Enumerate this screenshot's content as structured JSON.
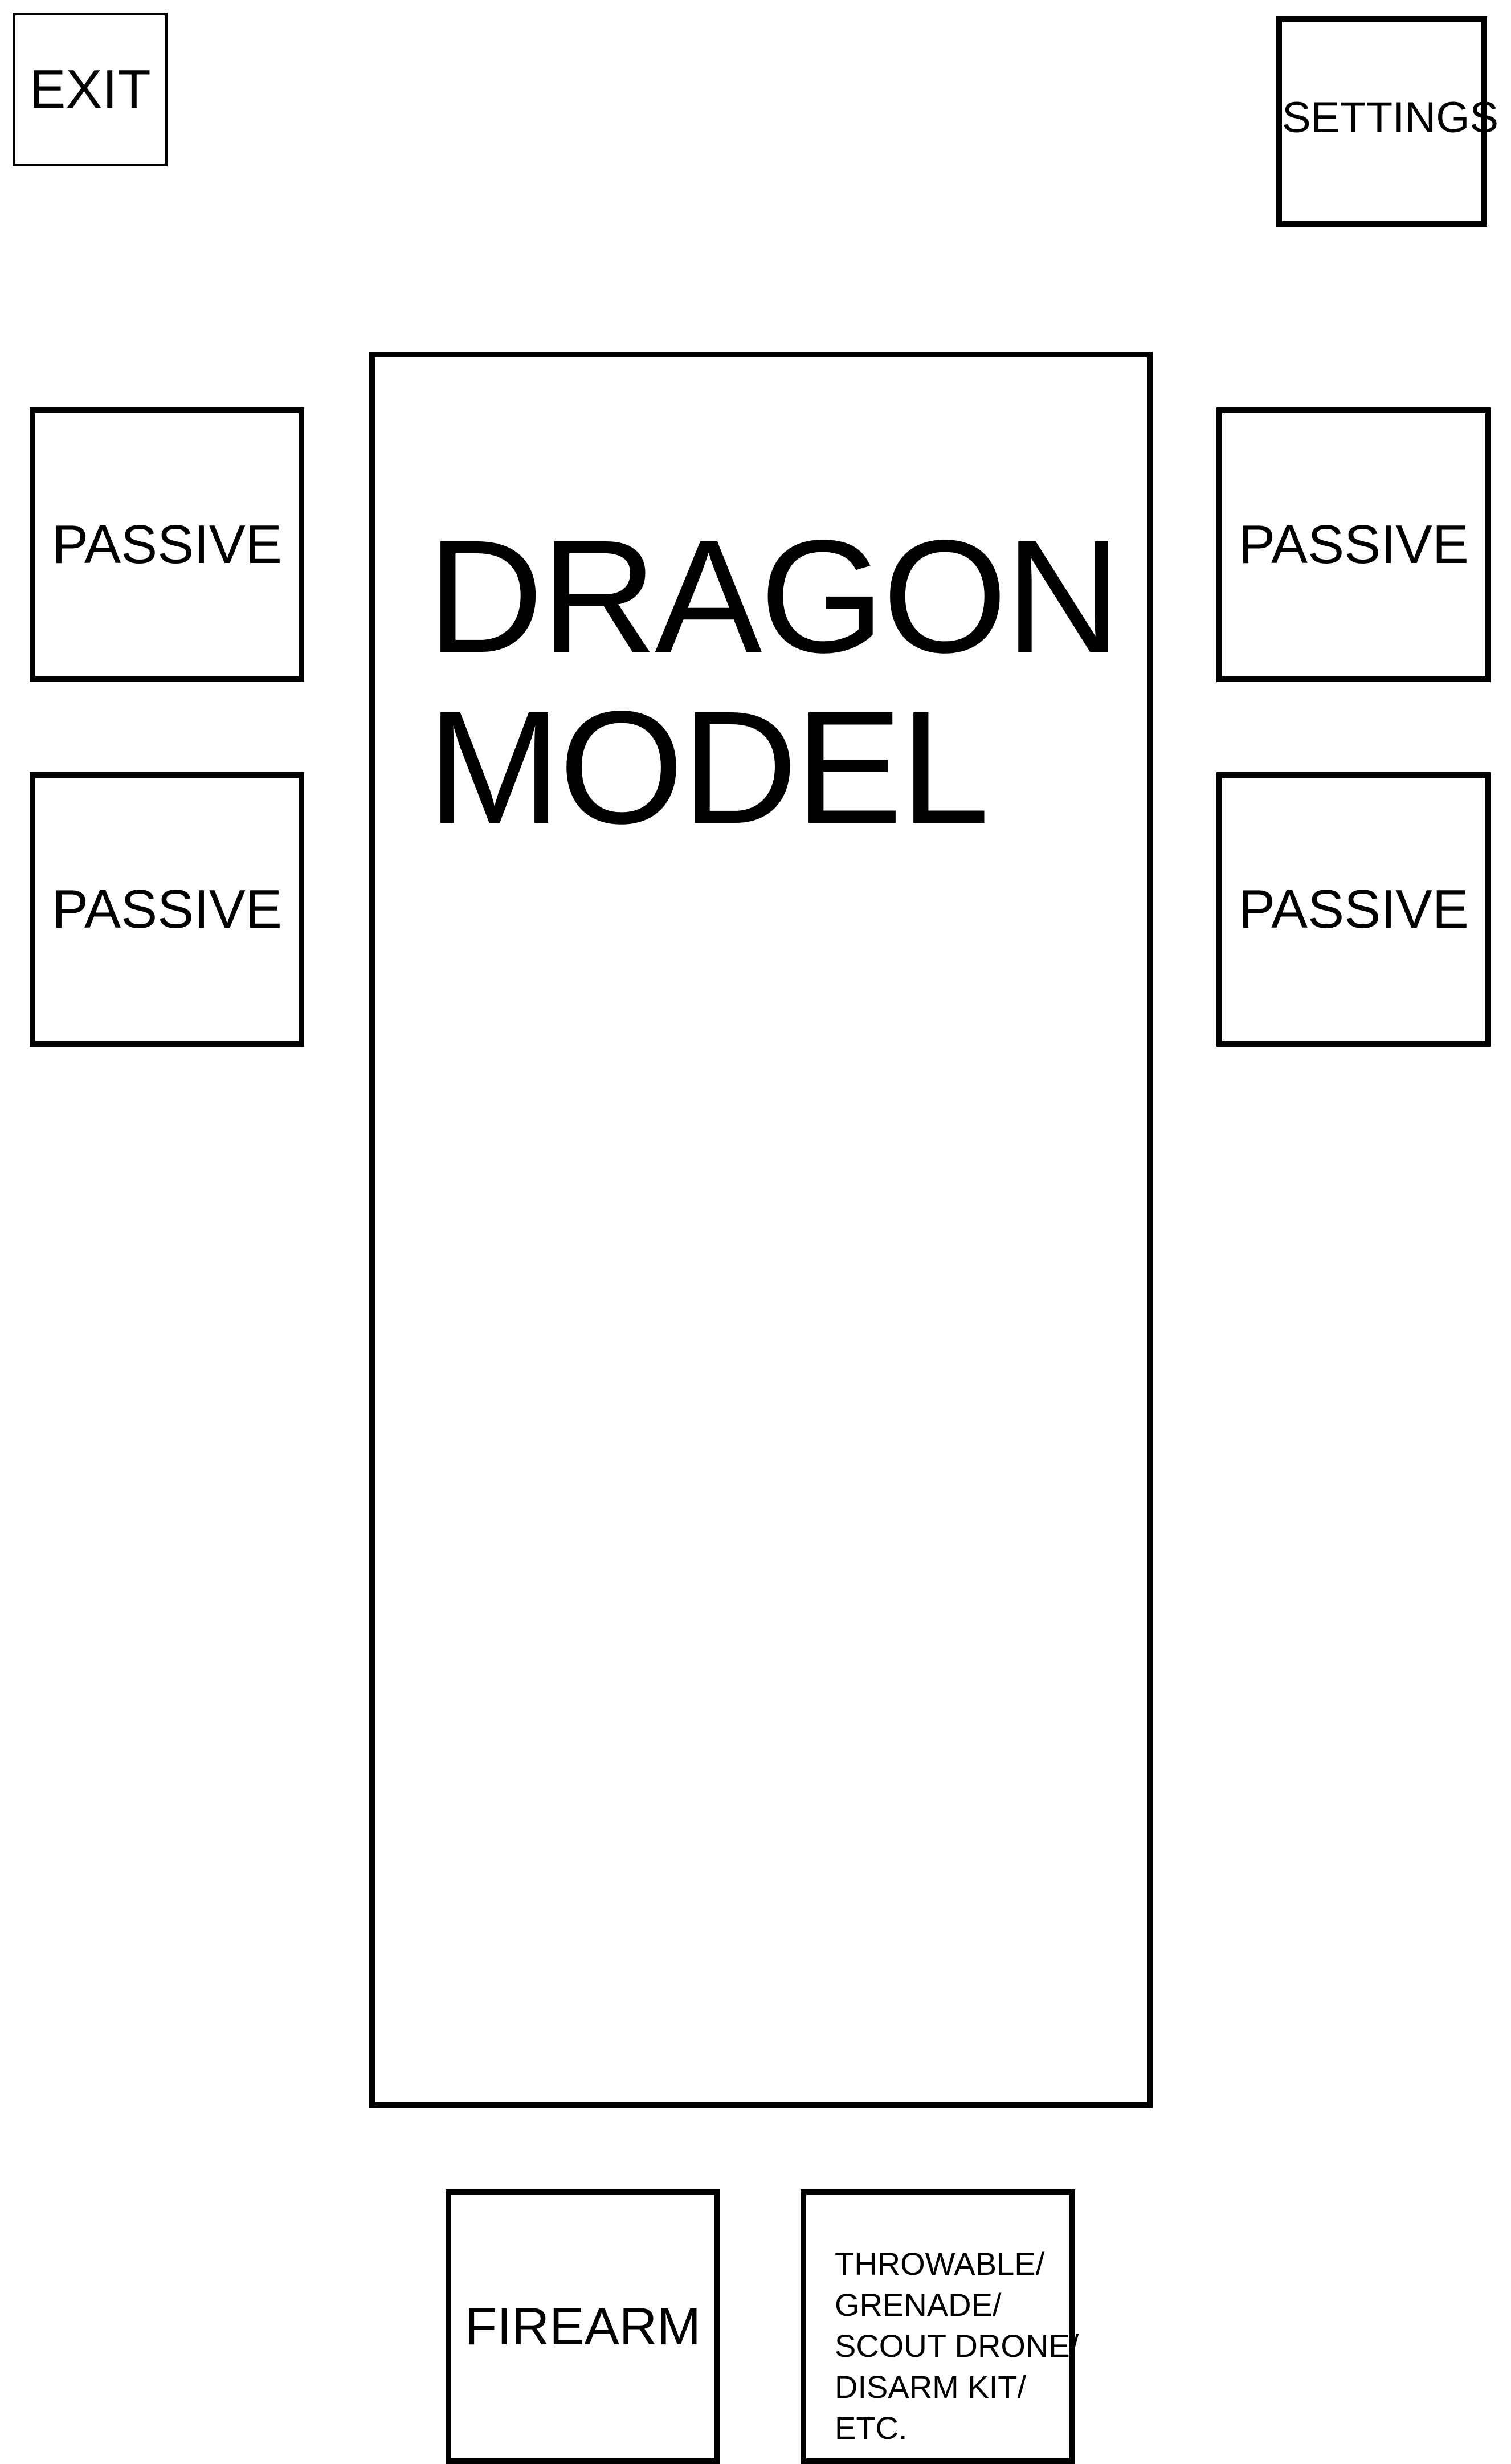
{
  "top_bar": {
    "exit_label": "EXIT",
    "settings_label": "SETTINGS"
  },
  "passives": {
    "left_top": "PASSIVE",
    "left_bottom": "PASSIVE",
    "right_top": "PASSIVE",
    "right_bottom": "PASSIVE"
  },
  "model_panel": {
    "title_line1": "DRAGON",
    "title_line2": "MODEL"
  },
  "loadout": {
    "firearm_label": "FIREARM",
    "throwable_lines": [
      "THROWABLE/",
      "GRENADE/",
      "SCOUT DRONE/",
      "DISARM KIT/",
      "ETC."
    ]
  },
  "colors": {
    "background": "#ffffff",
    "stroke": "#000000"
  }
}
